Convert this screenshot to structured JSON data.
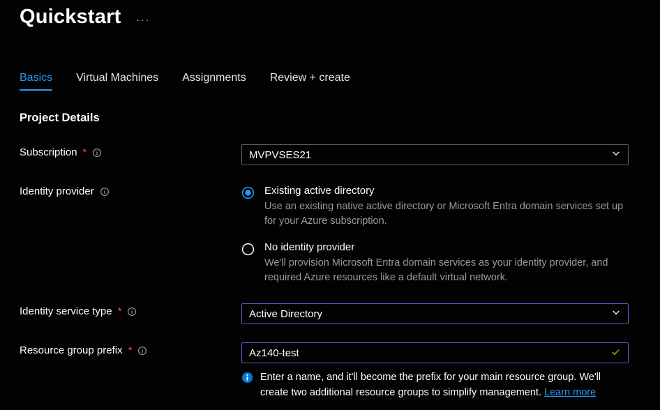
{
  "page": {
    "title": "Quickstart"
  },
  "tabs": {
    "items": [
      "Basics",
      "Virtual Machines",
      "Assignments",
      "Review + create"
    ],
    "activeIndex": 0
  },
  "section": {
    "projectDetails": "Project Details"
  },
  "labels": {
    "subscription": "Subscription",
    "identityProvider": "Identity provider",
    "identityServiceType": "Identity service type",
    "resourceGroupPrefix": "Resource group prefix"
  },
  "fields": {
    "subscription": {
      "value": "MVPVSES21"
    },
    "identityServiceType": {
      "value": "Active Directory"
    },
    "resourceGroupPrefix": {
      "value": "Az140-test"
    }
  },
  "identityOptions": {
    "existing": {
      "title": "Existing active directory",
      "desc": "Use an existing native active directory or Microsoft Entra domain services set up for your Azure subscription."
    },
    "none": {
      "title": "No identity provider",
      "desc": "We'll provision Microsoft Entra domain services as your identity provider, and required Azure resources like a default virtual network."
    },
    "selected": "existing"
  },
  "helper": {
    "text": "Enter a name, and it'll become the prefix for your main resource group. We'll create two additional resource groups to simplify management. ",
    "link": "Learn more"
  }
}
